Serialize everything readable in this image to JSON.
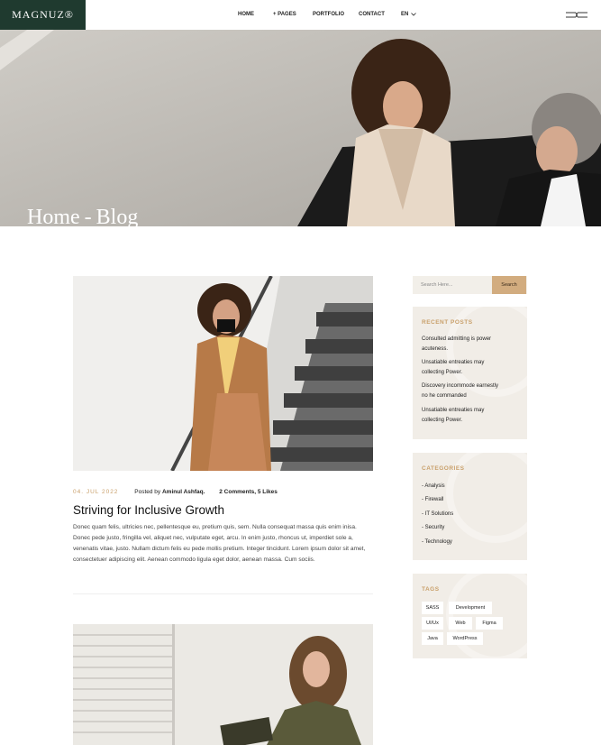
{
  "header": {
    "logo": "MAGNUZ®",
    "nav": {
      "home": "HOME",
      "pages": "+ PAGES",
      "portfolio": "PORTFOLIO",
      "contact": "CONTACT",
      "lang": "EN"
    }
  },
  "hero": {
    "crumb_home": "Home",
    "crumb_sep": "-",
    "crumb_current": "Blog"
  },
  "post": {
    "date": "04. JUL 2022",
    "posted_by": "Posted by",
    "author": "Aminul Ashfaq.",
    "comments": "2 Comments, 5 Likes",
    "title": "Striving for Inclusive Growth",
    "body": "Donec quam felis, ultricies nec, pellentesque eu, pretium quis, sem. Nulla consequat massa quis enim inisa. Donec pede justo, fringilla vel, aliquet nec, vulputate eget, arcu. In enim justo, rhoncus ut, imperdiet sole a, venenatis vitae, justo. Nullam dictum felis eu pede mollis pretium. Integer tincidunt. Lorem ipsum dolor sit amet, consectetuer adipiscing elit. Aenean commodo ligula eget dolor, aenean massa. Cum sociis."
  },
  "sidebar": {
    "search_placeholder": "Search Here...",
    "search_button": "Search",
    "recent_title": "RECENT POSTS",
    "recent": [
      {
        "line1": "Consulted admitting is power",
        "line2": "acuteness."
      },
      {
        "line1": "Unsatiable entreaties may",
        "line2": "collecting Power."
      },
      {
        "line1": "Discovery incommode earnestly",
        "line2": "no he commanded"
      },
      {
        "line1": "Unsatiable entreaties may",
        "line2": "collecting Power."
      }
    ],
    "categories_title": "CATEGORIES",
    "categories": [
      "- Analysis",
      "- Firewall",
      "- IT Solutions",
      "- Security",
      "- Technology"
    ],
    "tags_title": "TAGS",
    "tags": [
      "SASS",
      "Development",
      "UI/Ux",
      "Web",
      "Figma",
      "Java",
      "WordPress"
    ]
  },
  "colors": {
    "brand_dark": "#1f3a2f",
    "accent": "#c9a06b",
    "search_button": "#d2ac7f",
    "widget_bg": "#f1ede7"
  }
}
